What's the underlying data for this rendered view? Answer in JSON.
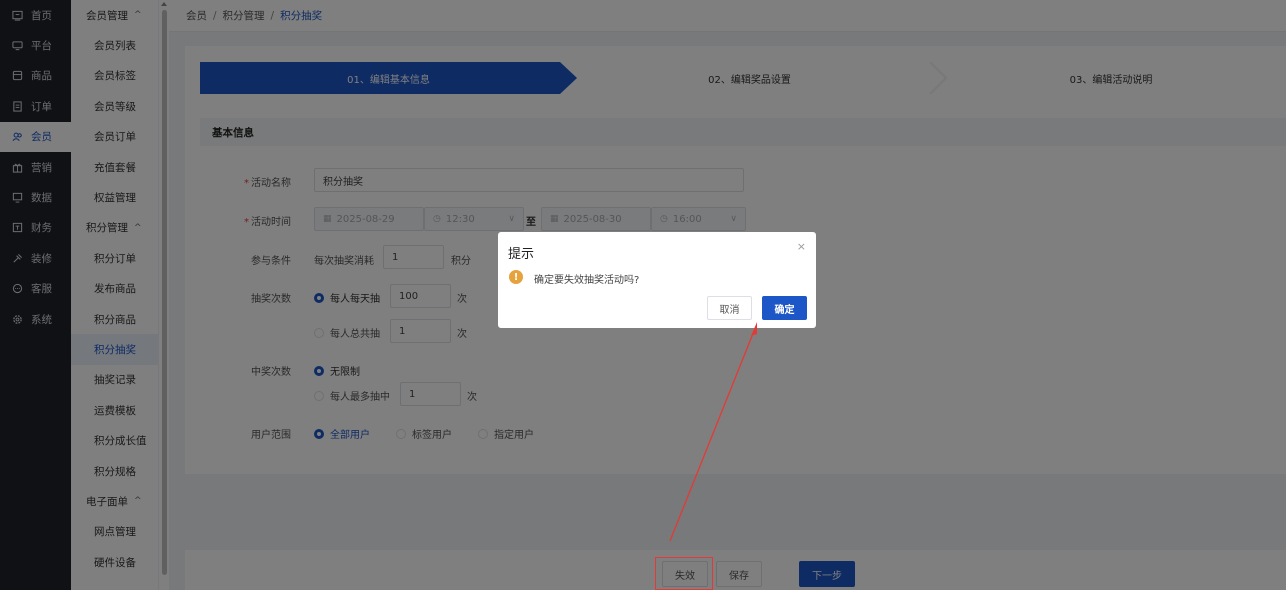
{
  "nav_primary": [
    {
      "label": "首页",
      "icon": "home-icon"
    },
    {
      "label": "平台",
      "icon": "monitor-icon"
    },
    {
      "label": "商品",
      "icon": "product-icon"
    },
    {
      "label": "订单",
      "icon": "order-icon"
    },
    {
      "label": "会员",
      "icon": "member-icon",
      "active": true
    },
    {
      "label": "营销",
      "icon": "gift-icon"
    },
    {
      "label": "数据",
      "icon": "chart-icon"
    },
    {
      "label": "财务",
      "icon": "finance-icon"
    },
    {
      "label": "装修",
      "icon": "decorate-icon"
    },
    {
      "label": "客服",
      "icon": "chat-icon"
    },
    {
      "label": "系统",
      "icon": "gear-icon"
    }
  ],
  "nav_secondary": {
    "group_member": "会员管理",
    "member_items": [
      "会员列表",
      "会员标签",
      "会员等级",
      "会员订单",
      "充值套餐",
      "权益管理"
    ],
    "group_points": "积分管理",
    "points_items": [
      "积分订单",
      "发布商品",
      "积分商品",
      "积分抽奖",
      "抽奖记录",
      "运费模板",
      "积分成长值",
      "积分规格"
    ],
    "group_waybill": "电子面单",
    "waybill_items": [
      "网点管理",
      "硬件设备"
    ]
  },
  "breadcrumb": {
    "level1": "会员",
    "level2": "积分管理",
    "level3": "积分抽奖",
    "sep": "/"
  },
  "steps": {
    "step1": "01、编辑基本信息",
    "step2": "02、编辑奖品设置",
    "step3": "03、编辑活动说明"
  },
  "section_title": "基本信息",
  "form": {
    "name_label": "活动名称",
    "name_value": "积分抽奖",
    "time_label": "活动时间",
    "start_date": "2025-08-29",
    "start_time": "12:30",
    "to": "至",
    "end_date": "2025-08-30",
    "end_time": "16:00",
    "cond_label": "参与条件",
    "cond_prefix": "每次抽奖消耗",
    "cond_value": "1",
    "cond_unit": "积分",
    "draws_label": "抽奖次数",
    "daily_label": "每人每天抽",
    "daily_value": "100",
    "total_label": "每人总共抽",
    "total_value": "1",
    "times_unit": "次",
    "win_label": "中奖次数",
    "win_unlimited": "无限制",
    "win_max_label": "每人最多抽中",
    "win_max_value": "1",
    "scope_label": "用户范围",
    "scope_all": "全部用户",
    "scope_tag": "标签用户",
    "scope_specified": "指定用户",
    "required_mark": "*"
  },
  "buttons": {
    "invalidate": "失效",
    "save": "保存",
    "next": "下一步"
  },
  "dialog": {
    "title": "提示",
    "message": "确定要失效抽奖活动吗?",
    "cancel": "取消",
    "confirm": "确定",
    "close": "×",
    "warn": "!"
  },
  "colors": {
    "primary": "#1d56c7",
    "sidebar": "#1f2329",
    "warning": "#e6a23c",
    "annotation": "#e53935"
  }
}
